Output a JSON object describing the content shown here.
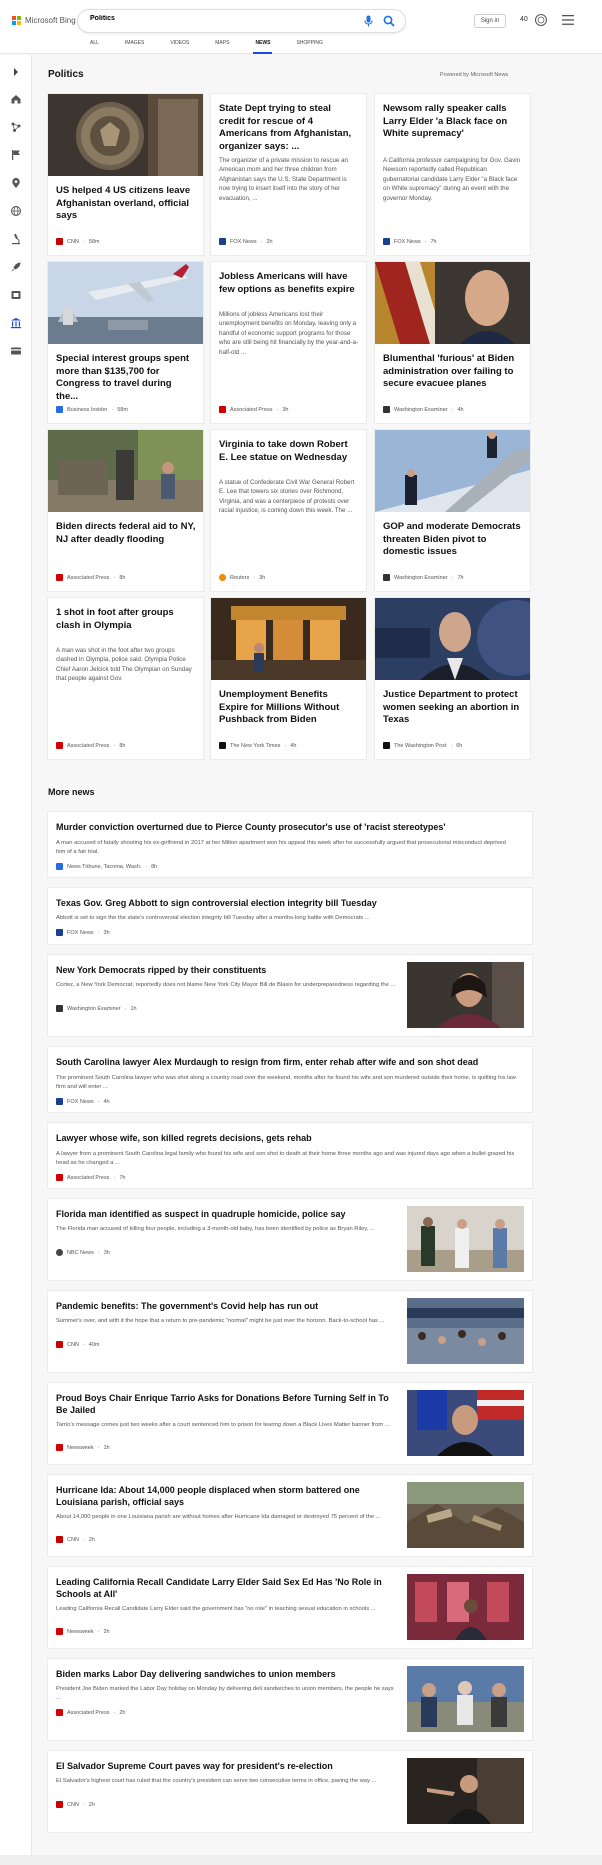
{
  "header": {
    "brand": "Microsoft Bing",
    "query": "Politics",
    "signin_label": "Sign in",
    "points": "40",
    "tabs": [
      {
        "label": "ALL"
      },
      {
        "label": "IMAGES"
      },
      {
        "label": "VIDEOS"
      },
      {
        "label": "MAPS"
      },
      {
        "label": "NEWS",
        "active": true
      },
      {
        "label": "SHOPPING"
      }
    ]
  },
  "rail": {
    "icons": [
      "chevron-right-icon",
      "home-icon",
      "network-icon",
      "flag-icon",
      "location-pin-icon",
      "globe-icon",
      "microscope-icon",
      "rocket-icon",
      "film-icon",
      "politics-building-icon",
      "card-icon"
    ]
  },
  "politics": {
    "title": "Politics",
    "powered_by": "Powered by Microsoft News",
    "cards": [
      {
        "title": "US helped 4 US citizens leave Afghanistan overland, official says",
        "desc": "",
        "source": "CNN",
        "time": "58m",
        "src_color": "#cc0000"
      },
      {
        "title": "State Dept trying to steal credit for rescue of 4 Americans from Afghanistan, organizer says: ...",
        "desc": "The organizer of a private mission to rescue an American mom and her three children from Afghanistan says the U.S. State Department is now trying to insert itself into the story of her evacuation, ...",
        "source": "FOX News",
        "time": "2h",
        "src_color": "#1a3f8c"
      },
      {
        "title": "Newsom rally speaker calls Larry Elder 'a Black face on White supremacy'",
        "desc": "A California professor campaigning for Gov. Gavin Newsom reportedly called Republican gubernatorial candidate Larry Elder \"a Black face on White supremacy\" during an event with the governor Monday.",
        "source": "FOX News",
        "time": "7h",
        "src_color": "#1a3f8c"
      },
      {
        "title": "Special interest groups spent more than $135,700 for Congress to travel during the...",
        "desc": "",
        "source": "Business Insider",
        "time": "58m",
        "src_color": "#2a6ce8"
      },
      {
        "title": "Jobless Americans will have few options as benefits expire",
        "desc": "Millions of jobless Americans lost their unemployment benefits on Monday, leaving only a handful of economic support programs for those who are still being hit financially by the year-and-a-half-old ...",
        "source": "Associated Press",
        "time": "3h",
        "src_color": "#d40000"
      },
      {
        "title": "Blumenthal 'furious' at Biden administration over failing to secure evacuee planes",
        "desc": "",
        "source": "Washington Examiner",
        "time": "4h",
        "src_color": "#333333"
      },
      {
        "title": "Biden directs federal aid to NY, NJ after deadly flooding",
        "desc": "",
        "source": "Associated Press",
        "time": "8h",
        "src_color": "#d40000"
      },
      {
        "title": "Virginia to take down Robert E. Lee statue on Wednesday",
        "desc": "A statue of Confederate Civil War General Robert E. Lee that towers six stories over Richmond, Virginia, and was a centerpiece of protests over racial injustice, is coming down this week. The ...",
        "source": "Reuters",
        "time": "3h",
        "src_color": "#f28c00"
      },
      {
        "title": "GOP and moderate Democrats threaten Biden pivot to domestic issues",
        "desc": "",
        "source": "Washington Examiner",
        "time": "7h",
        "src_color": "#333333"
      },
      {
        "title": "1 shot in foot after groups clash in Olympia",
        "desc": "A man was shot in the foot after two groups clashed in Olympia, police said. Olympia Police Chief Aaron Jelcick told The Olympian on Sunday that people against Gov.",
        "source": "Associated Press",
        "time": "8h",
        "src_color": "#d40000"
      },
      {
        "title": "Unemployment Benefits Expire for Millions Without Pushback from Biden",
        "desc": "",
        "source": "The New York Times",
        "time": "4h",
        "src_color": "#111111"
      },
      {
        "title": "Justice Department to protect women seeking an abortion in Texas",
        "desc": "",
        "source": "The Washington Post",
        "time": "6h",
        "src_color": "#111111"
      }
    ]
  },
  "more_news": {
    "title": "More news",
    "items": [
      {
        "title": "Murder conviction overturned due to Pierce County prosecutor's use of 'racist stereotypes'",
        "desc": "A man accused of fatally shooting his ex-girlfriend in 2017 at her Milton apartment won his appeal this week after he successfully argued that prosecutorial misconduct deprived him of a fair trial.",
        "source": "News Tribune, Tacoma, Wash.",
        "time": "8h",
        "src_color": "#2a6ce8"
      },
      {
        "title": "Texas Gov. Greg Abbott to sign controversial election integrity bill Tuesday",
        "desc": "Abbott is set to sign the the state's controversial election integrity bill Tuesday after a months-long battle with Democrats ...",
        "source": "FOX News",
        "time": "3h",
        "src_color": "#1a3f8c"
      },
      {
        "title": "New York Democrats ripped by their constituents",
        "desc": "Cortez, a New York Democrat, reportedly does not blame New York City Mayor Bill de Blasio for underpreparedness regarding the ...",
        "source": "Washington Examiner",
        "time": "1h",
        "src_color": "#333333"
      },
      {
        "title": "South Carolina lawyer Alex Murdaugh to resign from firm, enter rehab after wife and son shot dead",
        "desc": "The prominent South Carolina lawyer who was shot along a country road over the weekend, months after he found his wife and son murdered outside their home, is quitting his law firm and will enter ...",
        "source": "FOX News",
        "time": "4h",
        "src_color": "#1a3f8c"
      },
      {
        "title": "Lawyer whose wife, son killed regrets decisions, gets rehab",
        "desc": "A lawyer from a prominent South Carolina legal family who found his wife and son shot to death at their home three months ago and was injured days ago when a bullet grazed his head as he changed a ...",
        "source": "Associated Press",
        "time": "7h",
        "src_color": "#d40000"
      },
      {
        "title": "Florida man identified as suspect in quadruple homicide, police say",
        "desc": "The Florida man accused of killing four people, including a 3-month-old baby, has been identified by police as Bryan Riley, ...",
        "source": "NBC News",
        "time": "3h",
        "src_color": "#444444"
      },
      {
        "title": "Pandemic benefits: The government's Covid help has run out",
        "desc": "Summer's over, and with it the hope that a return to pre-pandemic \"normal\" might be just over the horizon. Back-to-school has ...",
        "source": "CNN",
        "time": "40m",
        "src_color": "#cc0000"
      },
      {
        "title": "Proud Boys Chair Enrique Tarrio Asks for Donations Before Turning Self in To Be Jailed",
        "desc": "Tarrio's message comes just two weeks after a court sentenced him to prison for tearing down a Black Lives Matter banner from ...",
        "source": "Newsweek",
        "time": "1h",
        "src_color": "#d40000"
      },
      {
        "title": "Hurricane Ida: About 14,000 people displaced when storm battered one Louisiana parish, official says",
        "desc": "About 14,000 people in one Louisiana parish are without homes after Hurricane Ida damaged or destroyed 75 percent of the ...",
        "source": "CNN",
        "time": "2h",
        "src_color": "#cc0000"
      },
      {
        "title": "Leading California Recall Candidate Larry Elder Said Sex Ed Has 'No Role in Schools at All'",
        "desc": "Leading California Recall Candidate Larry Elder said the government has \"no role\" in teaching sexual education in schools ...",
        "source": "Newsweek",
        "time": "2h",
        "src_color": "#d40000"
      },
      {
        "title": "Biden marks Labor Day delivering sandwiches to union members",
        "desc": "President Joe Biden marked the Labor Day holiday on Monday by delivering deli sandwiches to union members, the people he says ...",
        "source": "Associated Press",
        "time": "2h",
        "src_color": "#d40000"
      },
      {
        "title": "El Salvador Supreme Court paves way for president's re-election",
        "desc": "El Salvador's highest court has ruled that the country's president can serve two consecutive terms in office, paving the way ...",
        "source": "CNN",
        "time": "2h",
        "src_color": "#cc0000"
      }
    ]
  },
  "colors": {
    "accent": "#174ae4",
    "bing_blue": "#1a73e8"
  }
}
